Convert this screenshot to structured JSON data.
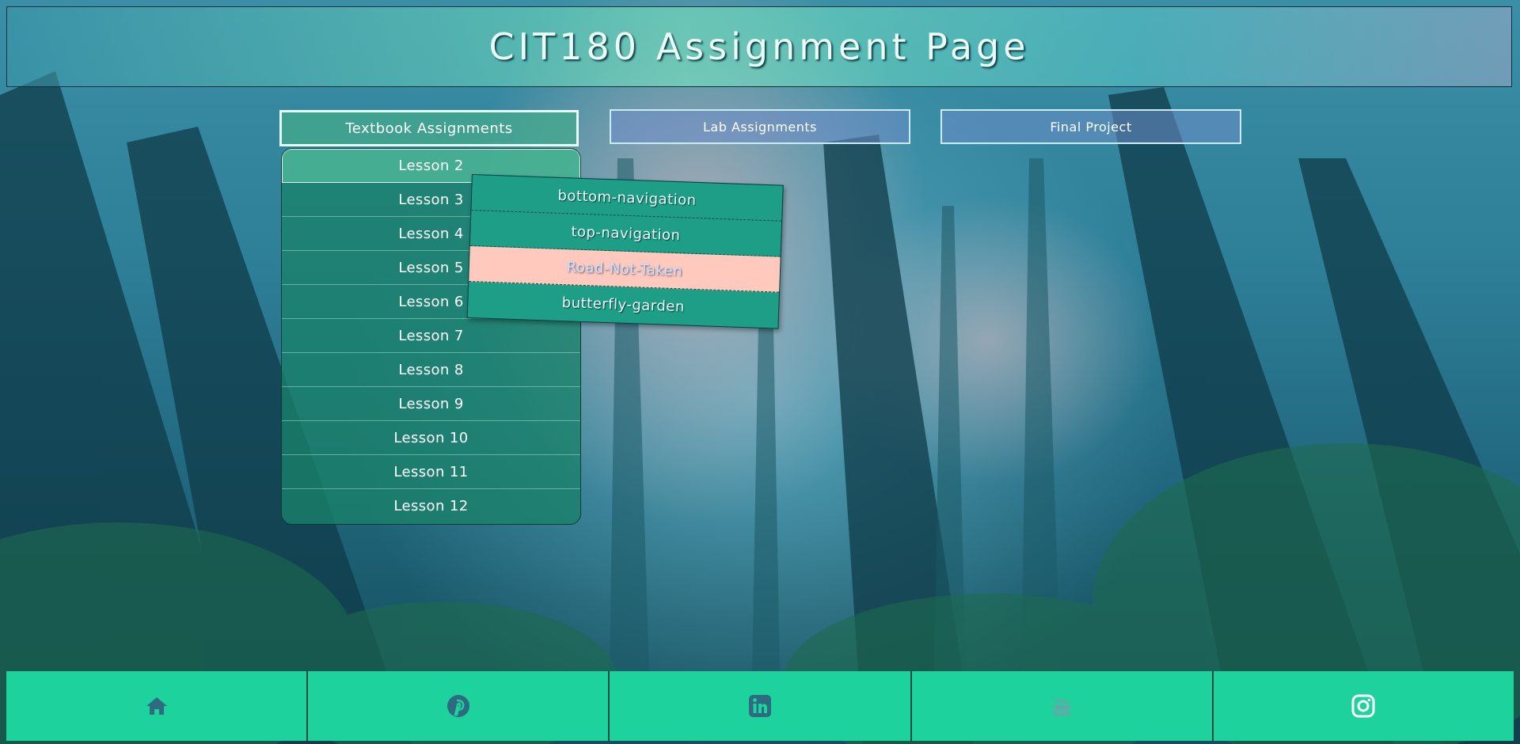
{
  "header": {
    "title": "CIT180 Assignment Page"
  },
  "nav": {
    "textbook": "Textbook Assignments",
    "lab": "Lab Assignments",
    "final": "Final Project"
  },
  "lessons": [
    "Lesson 2",
    "Lesson 3",
    "Lesson 4",
    "Lesson 5",
    "Lesson 6",
    "Lesson 7",
    "Lesson 8",
    "Lesson 9",
    "Lesson 10",
    "Lesson 11",
    "Lesson 12"
  ],
  "submenu": [
    "bottom-navigation",
    "top-navigation",
    "Road-Not-Taken",
    "butterfly-garden"
  ],
  "footer": {
    "icons": [
      "home-icon",
      "pinterest-icon",
      "linkedin-icon",
      "youtube-icon",
      "instagram-icon"
    ]
  },
  "colors": {
    "footer_bg": "#1ed29e",
    "icon_dark": "#2e6a80",
    "submenu_hover": "#ffc9bd"
  }
}
